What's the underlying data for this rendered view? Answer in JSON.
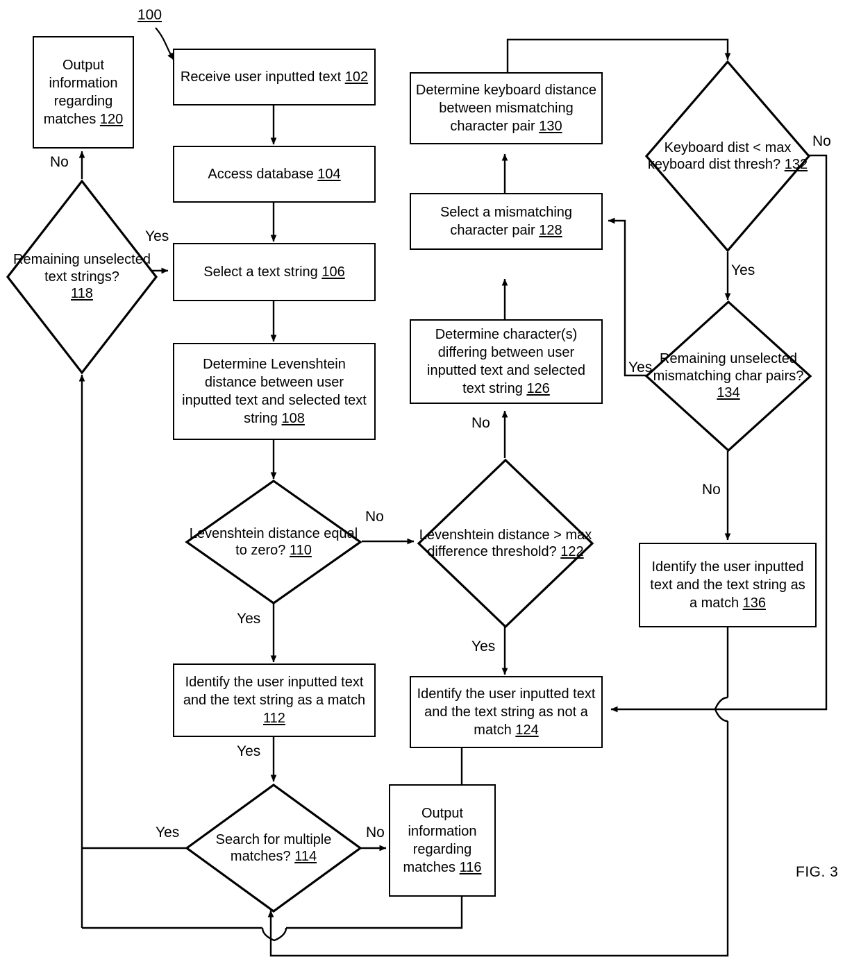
{
  "figure": {
    "label": "FIG. 3",
    "flow_reference": "100"
  },
  "nodes": {
    "n102": {
      "text": "Receive user inputted text ",
      "ref": "102",
      "shape": "process"
    },
    "n104": {
      "text": "Access database ",
      "ref": "104",
      "shape": "process"
    },
    "n106": {
      "text": "Select a text string ",
      "ref": "106",
      "shape": "process"
    },
    "n108": {
      "text": "Determine Levenshtein distance between user inputted text and selected text string ",
      "ref": "108",
      "shape": "process"
    },
    "n110": {
      "text": "Levenshtein distance equal to zero? ",
      "ref": "110",
      "shape": "decision"
    },
    "n112": {
      "text": "Identify the user inputted text and the text string as a match ",
      "ref": "112",
      "shape": "process"
    },
    "n114": {
      "text": "Search for multiple matches? ",
      "ref": "114",
      "shape": "decision"
    },
    "n116": {
      "text": "Output information regarding matches ",
      "ref": "116",
      "shape": "process"
    },
    "n118": {
      "text": "Remaining unselected text strings? ",
      "ref": "118",
      "shape": "decision"
    },
    "n120": {
      "text": "Output information regarding matches ",
      "ref": "120",
      "shape": "process"
    },
    "n122": {
      "text": "Levenshtein distance > max difference threshold? ",
      "ref": "122",
      "shape": "decision"
    },
    "n124": {
      "text": "Identify the user inputted text and the text string as not a match ",
      "ref": "124",
      "shape": "process"
    },
    "n126": {
      "text": "Determine character(s) differing between user inputted text and selected text string ",
      "ref": "126",
      "shape": "process"
    },
    "n128": {
      "text": "Select a mismatching character pair ",
      "ref": "128",
      "shape": "process"
    },
    "n130": {
      "text": "Determine keyboard distance between mismatching character pair ",
      "ref": "130",
      "shape": "process"
    },
    "n132": {
      "text": "Keyboard dist < max keyboard dist thresh? ",
      "ref": "132",
      "shape": "decision"
    },
    "n134": {
      "text": "Remaining unselected mismatching char pairs? ",
      "ref": "134",
      "shape": "decision"
    },
    "n136": {
      "text": "Identify the user inputted text and the text string as a match ",
      "ref": "136",
      "shape": "process"
    }
  },
  "edge_labels": {
    "e118_no": "No",
    "e118_yes": "Yes",
    "e110_no": "No",
    "e110_yes": "Yes",
    "e112_yes": "Yes",
    "e114_yes": "Yes",
    "e114_no": "No",
    "e122_no": "No",
    "e122_yes": "Yes",
    "e132_no": "No",
    "e132_yes": "Yes",
    "e134_yes": "Yes",
    "e134_no": "No"
  },
  "colors": {
    "stroke": "#000000",
    "background": "#ffffff",
    "text": "#000000"
  }
}
